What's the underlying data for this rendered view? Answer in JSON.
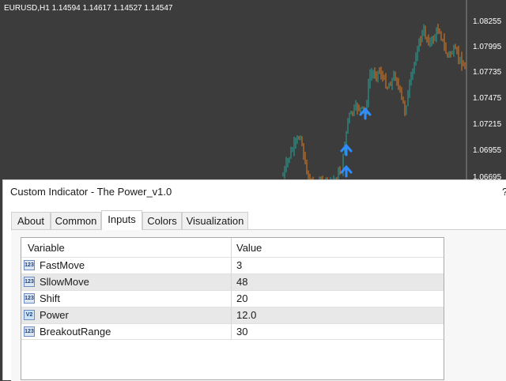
{
  "chart": {
    "symbol_line": "EURUSD,H1  1.14594 1.14617 1.14527 1.14547",
    "price_ticks": [
      "1.08255",
      "1.07995",
      "1.07735",
      "1.07475",
      "1.07215",
      "1.06955",
      "1.06695"
    ],
    "colors": {
      "background": "#3c3c3c",
      "up_candle": "#26a69a",
      "down_candle": "#e07b1f",
      "arrow": "#2f8cff",
      "text": "#ffffff"
    }
  },
  "dialog": {
    "title": "Custom Indicator - The Power_v1.0",
    "help": "?",
    "tabs": [
      {
        "label": "About"
      },
      {
        "label": "Common"
      },
      {
        "label": "Inputs",
        "active": true
      },
      {
        "label": "Colors"
      },
      {
        "label": "Visualization"
      }
    ],
    "grid": {
      "headers": {
        "variable": "Variable",
        "value": "Value"
      },
      "rows": [
        {
          "type_icon": "123",
          "name": "FastMove",
          "value": "3"
        },
        {
          "type_icon": "123",
          "name": "SllowMove",
          "value": "48"
        },
        {
          "type_icon": "123",
          "name": "Shift",
          "value": "20"
        },
        {
          "type_icon": "V2",
          "name": "Power",
          "value": "12.0"
        },
        {
          "type_icon": "123",
          "name": "BreakoutRange",
          "value": "30"
        }
      ]
    }
  }
}
